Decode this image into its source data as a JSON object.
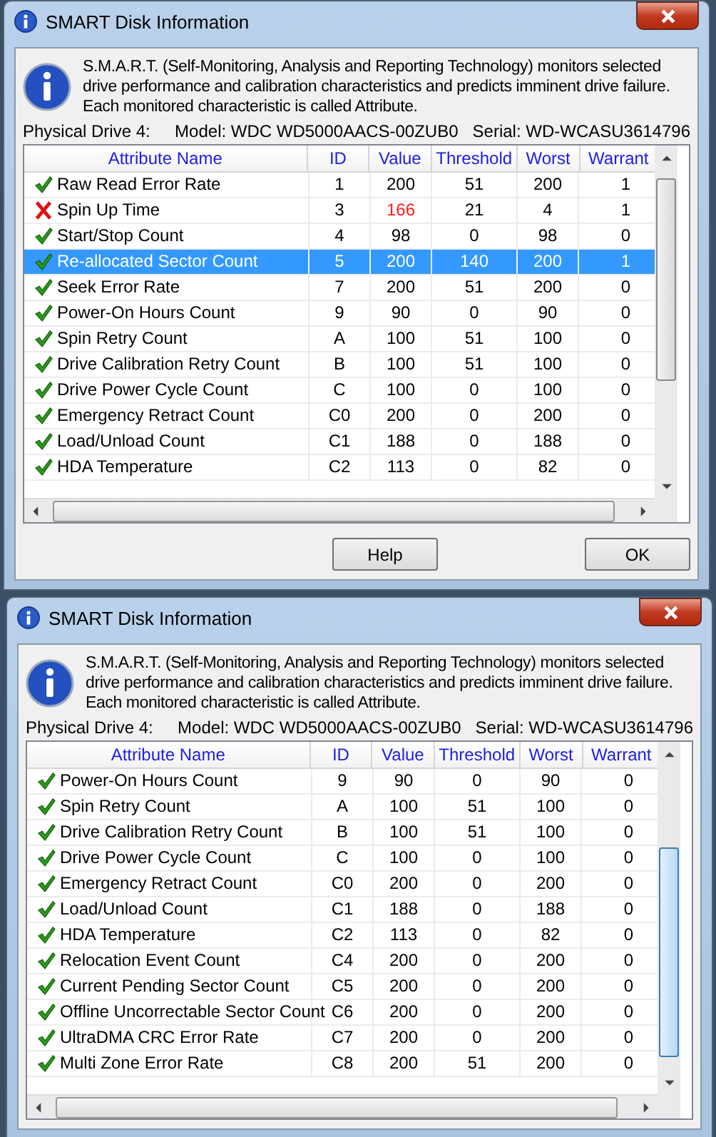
{
  "windows": [
    {
      "title": "SMART Disk Information",
      "info": "S.M.A.R.T. (Self-Monitoring, Analysis and Reporting Technology) monitors selected drive performance and calibration characteristics and predicts imminent drive failure. Each monitored characteristic is called Attribute.",
      "drive": "Physical Drive 4:",
      "model": "Model: WDC WD5000AACS-00ZUB0",
      "serial": "Serial: WD-WCASU3614796",
      "columns": [
        "Attribute Name",
        "ID",
        "Value",
        "Threshold",
        "Worst",
        "Warrant"
      ],
      "rows": [
        {
          "kind": "ok",
          "name": "Raw Read Error Rate",
          "id": "1",
          "value": "200",
          "threshold": "51",
          "worst": "200",
          "warranty": "1",
          "selected": false
        },
        {
          "kind": "fail",
          "name": "Spin Up Time",
          "id": "3",
          "value": "166",
          "threshold": "21",
          "worst": "4",
          "warranty": "1",
          "selected": false
        },
        {
          "kind": "ok",
          "name": "Start/Stop Count",
          "id": "4",
          "value": "98",
          "threshold": "0",
          "worst": "98",
          "warranty": "0",
          "selected": false
        },
        {
          "kind": "ok",
          "name": "Re-allocated Sector Count",
          "id": "5",
          "value": "200",
          "threshold": "140",
          "worst": "200",
          "warranty": "1",
          "selected": true
        },
        {
          "kind": "ok",
          "name": "Seek Error Rate",
          "id": "7",
          "value": "200",
          "threshold": "51",
          "worst": "200",
          "warranty": "0",
          "selected": false
        },
        {
          "kind": "ok",
          "name": "Power-On Hours Count",
          "id": "9",
          "value": "90",
          "threshold": "0",
          "worst": "90",
          "warranty": "0",
          "selected": false
        },
        {
          "kind": "ok",
          "name": "Spin Retry Count",
          "id": "A",
          "value": "100",
          "threshold": "51",
          "worst": "100",
          "warranty": "0",
          "selected": false
        },
        {
          "kind": "ok",
          "name": "Drive Calibration Retry Count",
          "id": "B",
          "value": "100",
          "threshold": "51",
          "worst": "100",
          "warranty": "0",
          "selected": false
        },
        {
          "kind": "ok",
          "name": "Drive Power Cycle Count",
          "id": "C",
          "value": "100",
          "threshold": "0",
          "worst": "100",
          "warranty": "0",
          "selected": false
        },
        {
          "kind": "ok",
          "name": "Emergency Retract Count",
          "id": "C0",
          "value": "200",
          "threshold": "0",
          "worst": "200",
          "warranty": "0",
          "selected": false
        },
        {
          "kind": "ok",
          "name": "Load/Unload Count",
          "id": "C1",
          "value": "188",
          "threshold": "0",
          "worst": "188",
          "warranty": "0",
          "selected": false
        },
        {
          "kind": "ok",
          "name": "HDA Temperature",
          "id": "C2",
          "value": "113",
          "threshold": "0",
          "worst": "82",
          "warranty": "0",
          "selected": false
        }
      ],
      "buttons": [
        "Help",
        "OK"
      ]
    },
    {
      "title": "SMART Disk Information",
      "info": "S.M.A.R.T. (Self-Monitoring, Analysis and Reporting Technology) monitors selected drive performance and calibration characteristics and predicts imminent drive failure. Each monitored characteristic is called Attribute.",
      "drive": "Physical Drive 4:",
      "model": "Model: WDC WD5000AACS-00ZUB0",
      "serial": "Serial: WD-WCASU3614796",
      "columns": [
        "Attribute Name",
        "ID",
        "Value",
        "Threshold",
        "Worst",
        "Warrant"
      ],
      "rows": [
        {
          "kind": "ok",
          "name": "Power-On Hours Count",
          "id": "9",
          "value": "90",
          "threshold": "0",
          "worst": "90",
          "warranty": "0",
          "selected": false
        },
        {
          "kind": "ok",
          "name": "Spin Retry Count",
          "id": "A",
          "value": "100",
          "threshold": "51",
          "worst": "100",
          "warranty": "0",
          "selected": false
        },
        {
          "kind": "ok",
          "name": "Drive Calibration Retry Count",
          "id": "B",
          "value": "100",
          "threshold": "51",
          "worst": "100",
          "warranty": "0",
          "selected": false
        },
        {
          "kind": "ok",
          "name": "Drive Power Cycle Count",
          "id": "C",
          "value": "100",
          "threshold": "0",
          "worst": "100",
          "warranty": "0",
          "selected": false
        },
        {
          "kind": "ok",
          "name": "Emergency Retract Count",
          "id": "C0",
          "value": "200",
          "threshold": "0",
          "worst": "200",
          "warranty": "0",
          "selected": false
        },
        {
          "kind": "ok",
          "name": "Load/Unload Count",
          "id": "C1",
          "value": "188",
          "threshold": "0",
          "worst": "188",
          "warranty": "0",
          "selected": false
        },
        {
          "kind": "ok",
          "name": "HDA Temperature",
          "id": "C2",
          "value": "113",
          "threshold": "0",
          "worst": "82",
          "warranty": "0",
          "selected": false
        },
        {
          "kind": "ok",
          "name": "Relocation Event Count",
          "id": "C4",
          "value": "200",
          "threshold": "0",
          "worst": "200",
          "warranty": "0",
          "selected": false
        },
        {
          "kind": "ok",
          "name": "Current Pending Sector Count",
          "id": "C5",
          "value": "200",
          "threshold": "0",
          "worst": "200",
          "warranty": "0",
          "selected": false
        },
        {
          "kind": "ok",
          "name": "Offline Uncorrectable Sector Count",
          "id": "C6",
          "value": "200",
          "threshold": "0",
          "worst": "200",
          "warranty": "0",
          "selected": false
        },
        {
          "kind": "ok",
          "name": "UltraDMA CRC Error Rate",
          "id": "C7",
          "value": "200",
          "threshold": "0",
          "worst": "200",
          "warranty": "0",
          "selected": false
        },
        {
          "kind": "ok",
          "name": "Multi Zone Error Rate",
          "id": "C8",
          "value": "200",
          "threshold": "51",
          "worst": "200",
          "warranty": "0",
          "selected": false
        }
      ]
    }
  ]
}
